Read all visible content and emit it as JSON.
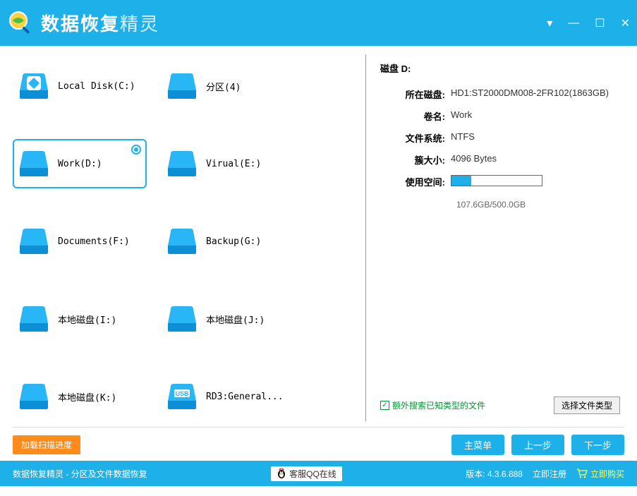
{
  "app": {
    "title_main": "数据恢复",
    "title_accent": "精灵"
  },
  "drives": [
    {
      "label": "Local Disk(C:)",
      "type": "local-special"
    },
    {
      "label": "分区(4)",
      "type": "disk"
    },
    {
      "label": "Work(D:)",
      "type": "disk",
      "selected": true
    },
    {
      "label": "Virual(E:)",
      "type": "disk"
    },
    {
      "label": "Documents(F:)",
      "type": "disk"
    },
    {
      "label": "Backup(G:)",
      "type": "disk"
    },
    {
      "label": "本地磁盘(I:)",
      "type": "disk"
    },
    {
      "label": "本地磁盘(J:)",
      "type": "disk"
    },
    {
      "label": "本地磁盘(K:)",
      "type": "disk"
    },
    {
      "label": "RD3:General...",
      "type": "usb"
    }
  ],
  "info": {
    "title": "磁盘 D:",
    "rows": {
      "host_disk_key": "所在磁盘:",
      "host_disk_val": "HD1:ST2000DM008-2FR102(1863GB)",
      "vol_name_key": "卷名:",
      "vol_name_val": "Work",
      "fs_key": "文件系统:",
      "fs_val": "NTFS",
      "cluster_key": "簇大小:",
      "cluster_val": "4096 Bytes",
      "usage_key": "使用空间:",
      "usage_text": "107.6GB/500.0GB",
      "usage_percent": 21.5
    }
  },
  "options": {
    "extra_search_label": "额外搜索已知类型的文件",
    "select_types_label": "选择文件类型"
  },
  "actions": {
    "load_progress": "加载扫描进度",
    "main_menu": "主菜单",
    "prev": "上一步",
    "next": "下一步"
  },
  "status": {
    "breadcrumb": "数据恢复精灵 - 分区及文件数据恢复",
    "qq": "客服QQ在线",
    "version_label": "版本: 4.3.6.888",
    "register": "立即注册",
    "buy": "立即购买"
  }
}
